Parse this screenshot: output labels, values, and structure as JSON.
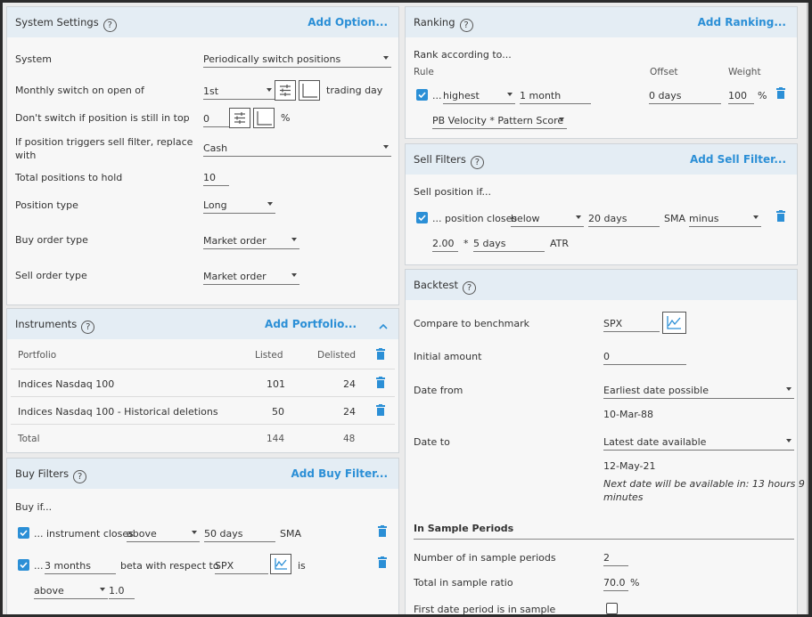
{
  "system_settings": {
    "title": "System Settings",
    "help": "?",
    "add": "Add Option...",
    "system_label": "System",
    "system_value": "Periodically switch positions",
    "monthly_label": "Monthly switch on open of",
    "monthly_value": "1st",
    "monthly_suffix": "trading day",
    "dont_switch_label": "Don't switch if position is still in top",
    "dont_switch_value": "0",
    "dont_switch_suffix": "%",
    "replace_label_1": "If position triggers sell filter, replace",
    "replace_label_2": "with",
    "replace_value": "Cash",
    "total_label": "Total positions to hold",
    "total_value": "10",
    "ptype_label": "Position type",
    "ptype_value": "Long",
    "buy_order_label": "Buy order type",
    "buy_order_value": "Market order",
    "sell_order_label": "Sell order type",
    "sell_order_value": "Market order"
  },
  "instruments": {
    "title": "Instruments",
    "help": "?",
    "add": "Add Portfolio...",
    "col_portfolio": "Portfolio",
    "col_listed": "Listed",
    "col_delisted": "Delisted",
    "rows": [
      {
        "name": "Indices Nasdaq 100",
        "listed": "101",
        "delisted": "24"
      },
      {
        "name": "Indices Nasdaq 100 - Historical deletions",
        "listed": "50",
        "delisted": "24"
      }
    ],
    "total_label": "Total",
    "total_listed": "144",
    "total_delisted": "48"
  },
  "buy_filters": {
    "title": "Buy Filters",
    "help": "?",
    "add": "Add Buy Filter...",
    "intro": "Buy if...",
    "f1_prefix": "... instrument closes",
    "f1_op": "above",
    "f1_period": "50 days",
    "f1_ind": "SMA",
    "f2_prefix": "...",
    "f2_period": "3 months",
    "f2_mid": "beta with respect to",
    "f2_symbol": "SPX",
    "f2_is": "is",
    "f2_op": "above",
    "f2_value": "1.0"
  },
  "ranking": {
    "title": "Ranking",
    "help": "?",
    "add": "Add Ranking...",
    "intro": "Rank according to...",
    "col_rule": "Rule",
    "col_offset": "Offset",
    "col_weight": "Weight",
    "rule_prefix": "...",
    "rule_dir": "highest",
    "rule_period": "1 month",
    "rule_offset": "0 days",
    "rule_weight": "100",
    "rule_pct": "%",
    "rule_metric": "PB Velocity * Pattern Score"
  },
  "sell_filters": {
    "title": "Sell Filters",
    "help": "?",
    "add": "Add Sell Filter...",
    "intro": "Sell position if...",
    "prefix": "... position closes",
    "op": "below",
    "period": "20 days",
    "ind": "SMA",
    "op2": "minus",
    "mult": "2.00",
    "star": "*",
    "atr_period": "5 days",
    "atr": "ATR"
  },
  "backtest": {
    "title": "Backtest",
    "help": "?",
    "bench_label": "Compare to benchmark",
    "bench_value": "SPX",
    "init_label": "Initial amount",
    "init_value": "0",
    "from_label": "Date from",
    "from_value": "Earliest date possible",
    "from_date": "10-Mar-88",
    "to_label": "Date to",
    "to_value": "Latest date available",
    "to_date": "12-May-21",
    "next_note_1": "Next date will be available in: 13 hours 9",
    "next_note_2": "minutes",
    "isp_heading": "In Sample Periods",
    "nisp_label": "Number of in sample periods",
    "nisp_value": "2",
    "ratio_label": "Total in sample ratio",
    "ratio_value": "70.0",
    "ratio_pct": "%",
    "first_label": "First date period is in sample"
  },
  "colors": {
    "accent": "#2b8fd6",
    "header_bg": "#e4edf4",
    "panel_bg": "#f7f7f7"
  }
}
